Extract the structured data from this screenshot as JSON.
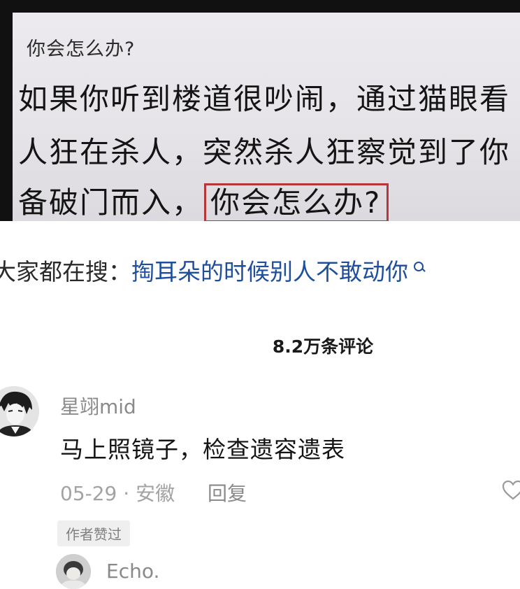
{
  "video": {
    "question_small": "你会怎么办?",
    "line1": "如果你听到楼道很吵闹，通过猫眼看",
    "line2": "人狂在杀人，突然杀人狂察觉到了你",
    "line3_prefix": "备破门而入，",
    "line3_highlight": "你会怎么办?"
  },
  "search": {
    "prefix": "大家都在搜：",
    "query": "掏耳朵的时候别人不敢动你"
  },
  "comments": {
    "count_label": "8.2万条评论",
    "top_comment": {
      "username": "星翊mid",
      "text": "马上照镜子，检查遗容遗表",
      "date": "05-29",
      "location": "安徽",
      "reply_label": "回复",
      "author_liked_badge": "作者赞过"
    },
    "reply_preview": {
      "username": "Echo."
    }
  },
  "colors": {
    "highlight_border": "#b5373a",
    "search_link": "#1f4f9c"
  }
}
